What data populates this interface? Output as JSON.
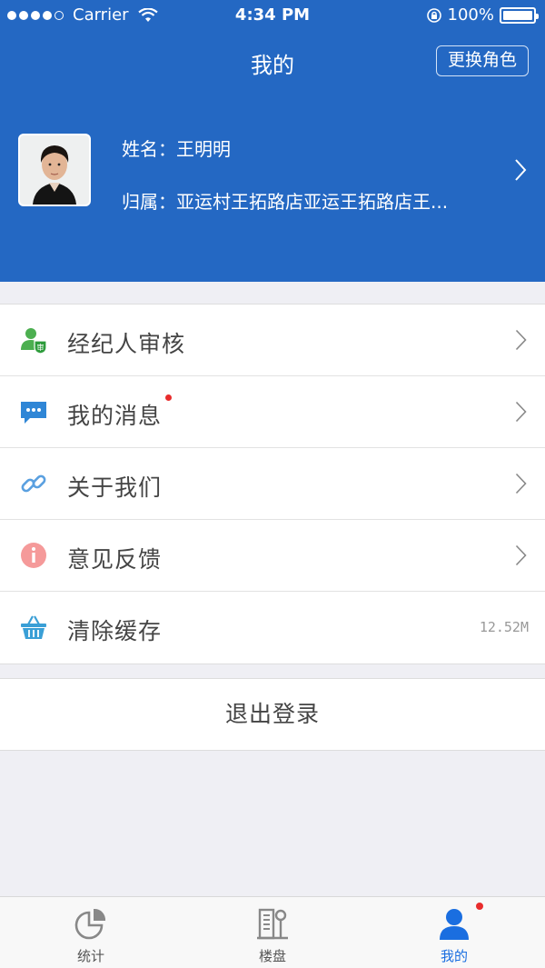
{
  "status_bar": {
    "carrier": "Carrier",
    "time": "4:34 PM",
    "battery": "100%"
  },
  "header": {
    "title": "我的",
    "switch_role_label": "更换角色"
  },
  "profile": {
    "name_line": "姓名：王明明",
    "belong_line": "归属：亚运村王拓路店亚运王拓路店王..."
  },
  "menu": {
    "items": [
      {
        "label": "经纪人审核",
        "icon": "agent-review-icon",
        "icon_badge": "审"
      },
      {
        "label": "我的消息",
        "icon": "message-icon",
        "unread": true
      },
      {
        "label": "关于我们",
        "icon": "link-icon"
      },
      {
        "label": "意见反馈",
        "icon": "info-icon"
      },
      {
        "label": "清除缓存",
        "icon": "basket-icon",
        "value": "12.52M"
      }
    ]
  },
  "logout_label": "退出登录",
  "tabbar": {
    "tabs": [
      {
        "label": "统计",
        "icon": "pie-chart-icon",
        "active": false
      },
      {
        "label": "楼盘",
        "icon": "building-icon",
        "active": false
      },
      {
        "label": "我的",
        "icon": "person-icon",
        "active": true,
        "badge": true
      }
    ]
  },
  "colors": {
    "header_bg": "#2468c3",
    "accent": "#1a6ee0",
    "badge": "#e82c2c"
  }
}
